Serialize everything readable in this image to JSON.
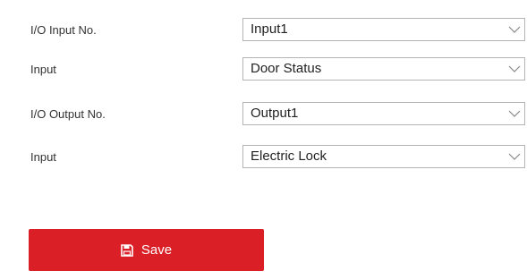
{
  "form": {
    "rows": [
      {
        "label": "I/O Input No.",
        "value": "Input1"
      },
      {
        "label": "Input",
        "value": "Door Status"
      },
      {
        "label": "I/O Output No.",
        "value": "Output1"
      },
      {
        "label": "Input",
        "value": "Electric Lock"
      }
    ]
  },
  "actions": {
    "save_label": "Save",
    "save_icon": "floppy-disk-icon"
  },
  "colors": {
    "primary": "#da1f26",
    "border": "#b4b4b4",
    "label_text": "#333333",
    "chevron": "#8a8a8a"
  },
  "icons": {
    "dropdown": "chevron-down-icon"
  }
}
